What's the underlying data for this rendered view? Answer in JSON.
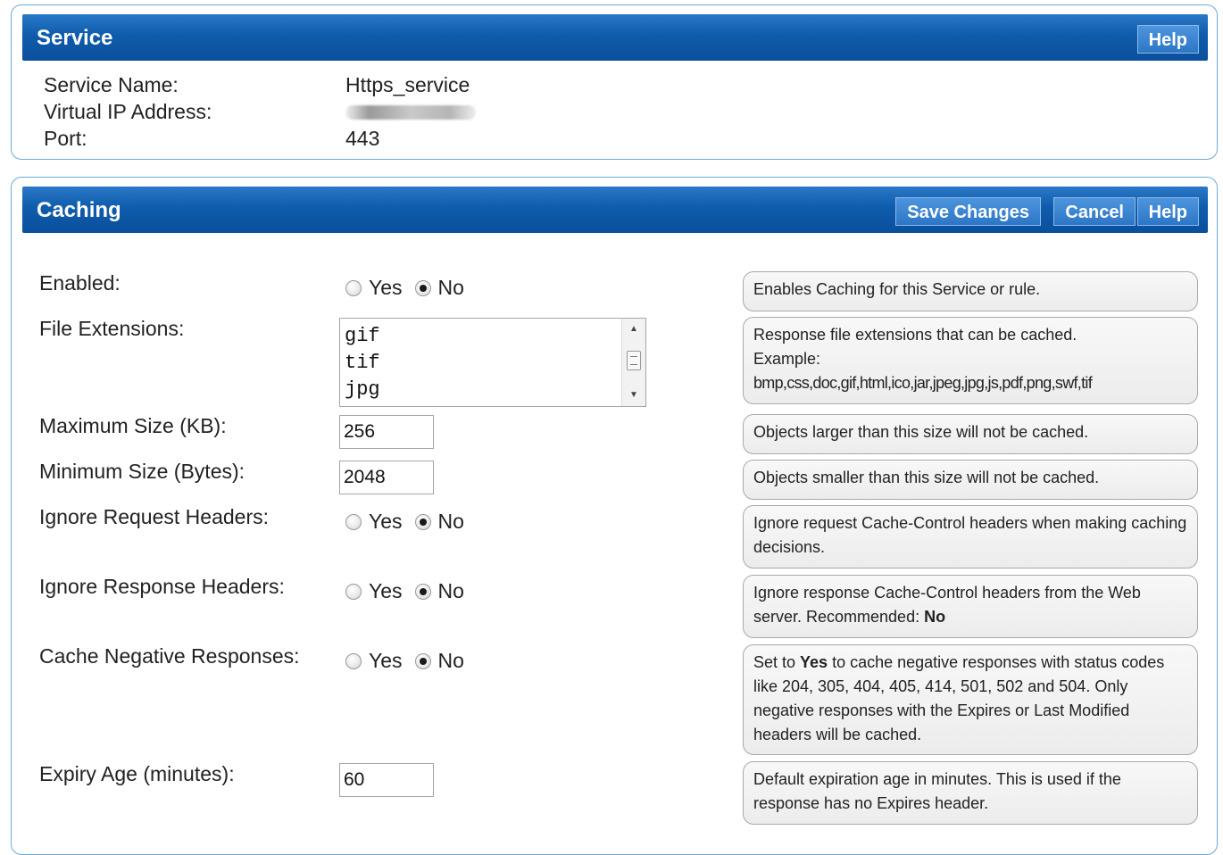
{
  "service": {
    "title": "Service",
    "help_label": "Help",
    "name_label": "Service Name:",
    "name_value": "Https_service",
    "vip_label": "Virtual IP Address:",
    "port_label": "Port:",
    "port_value": "443"
  },
  "caching": {
    "title": "Caching",
    "save_label": "Save Changes",
    "cancel_label": "Cancel",
    "help_label": "Help",
    "yes": "Yes",
    "no": "No",
    "enabled": {
      "label": "Enabled:",
      "selected": "No",
      "hint": "Enables Caching for this Service or rule."
    },
    "file_extensions": {
      "label": "File Extensions:",
      "items": [
        "gif",
        "tif",
        "jpg"
      ],
      "hint_line1": "Response file extensions that can be cached.",
      "hint_line2": "Example:",
      "hint_line3": "bmp,css,doc,gif,html,ico,jar,jpeg,jpg,js,pdf,png,swf,tif"
    },
    "max_size": {
      "label": "Maximum Size (KB):",
      "value": "256",
      "hint": "Objects larger than this size will not be cached."
    },
    "min_size": {
      "label": "Minimum Size (Bytes):",
      "value": "2048",
      "hint": "Objects smaller than this size will not be cached."
    },
    "ignore_request": {
      "label": "Ignore Request Headers:",
      "selected": "No",
      "hint": "Ignore request Cache-Control headers when making caching decisions."
    },
    "ignore_response": {
      "label": "Ignore Response Headers:",
      "selected": "No",
      "hint_prefix": "Ignore response Cache-Control headers from the Web server. Recommended: ",
      "hint_bold": "No"
    },
    "cache_negative": {
      "label": "Cache Negative Responses:",
      "selected": "No",
      "hint_prefix": "Set to ",
      "hint_bold": "Yes",
      "hint_suffix": " to cache negative responses with status codes like 204, 305, 404, 405, 414, 501, 502 and 504. Only negative responses with the Expires or Last Modified headers will be cached."
    },
    "expiry_age": {
      "label": "Expiry Age (minutes):",
      "value": "60",
      "hint": "Default expiration age in minutes. This is used if the response has no Expires header."
    }
  },
  "colors": {
    "header_blue": "#0f5cac",
    "panel_border": "#6fa9d8"
  }
}
